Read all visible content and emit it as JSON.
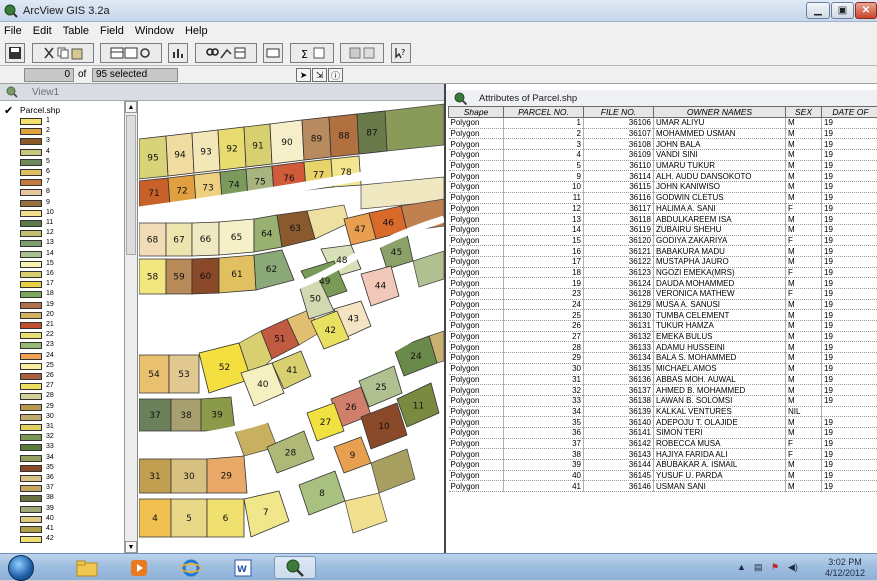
{
  "window": {
    "title": "ArcView GIS 3.2a"
  },
  "menu": [
    "File",
    "Edit",
    "Table",
    "Field",
    "Window",
    "Help"
  ],
  "status": {
    "selected_count": "0",
    "of_label": "of",
    "total": "95",
    "selected_label": "selected"
  },
  "view": {
    "title": "View1",
    "layer_name": "Parcel.shp",
    "legend": [
      {
        "label": "1",
        "color": "#f4e26a"
      },
      {
        "label": "2",
        "color": "#e0a23c"
      },
      {
        "label": "3",
        "color": "#8f5a2a"
      },
      {
        "label": "4",
        "color": "#c8c77f"
      },
      {
        "label": "5",
        "color": "#6f8a5a"
      },
      {
        "label": "6",
        "color": "#e0c060"
      },
      {
        "label": "7",
        "color": "#c47a3e"
      },
      {
        "label": "8",
        "color": "#e8c8a0"
      },
      {
        "label": "9",
        "color": "#9a7040"
      },
      {
        "label": "10",
        "color": "#f0e090"
      },
      {
        "label": "11",
        "color": "#5c7a4a"
      },
      {
        "label": "12",
        "color": "#c0c070"
      },
      {
        "label": "13",
        "color": "#7f9e6e"
      },
      {
        "label": "14",
        "color": "#a8c090"
      },
      {
        "label": "15",
        "color": "#f7f0b0"
      },
      {
        "label": "16",
        "color": "#d8d070"
      },
      {
        "label": "17",
        "color": "#e8d040"
      },
      {
        "label": "18",
        "color": "#7aa65c"
      },
      {
        "label": "19",
        "color": "#b0704a"
      },
      {
        "label": "20",
        "color": "#d4b060"
      },
      {
        "label": "21",
        "color": "#c05030"
      },
      {
        "label": "22",
        "color": "#e8e070"
      },
      {
        "label": "23",
        "color": "#98b878"
      },
      {
        "label": "24",
        "color": "#f0a050"
      },
      {
        "label": "25",
        "color": "#f8f0a0"
      },
      {
        "label": "26",
        "color": "#a86040"
      },
      {
        "label": "27",
        "color": "#f0e060"
      },
      {
        "label": "28",
        "color": "#d0d098"
      },
      {
        "label": "29",
        "color": "#b89a50"
      },
      {
        "label": "30",
        "color": "#c0a870"
      },
      {
        "label": "31",
        "color": "#e0d060"
      },
      {
        "label": "32",
        "color": "#7a9858"
      },
      {
        "label": "33",
        "color": "#5a7a3a"
      },
      {
        "label": "34",
        "color": "#9aa060"
      },
      {
        "label": "35",
        "color": "#8a4a2a"
      },
      {
        "label": "36",
        "color": "#d8c088"
      },
      {
        "label": "37",
        "color": "#c8a860"
      },
      {
        "label": "38",
        "color": "#6a7040"
      },
      {
        "label": "39",
        "color": "#a0a878"
      },
      {
        "label": "40",
        "color": "#e0c880"
      },
      {
        "label": "41",
        "color": "#b0a048"
      },
      {
        "label": "42",
        "color": "#eee070"
      }
    ],
    "parcels": [
      {
        "n": "95",
        "c": "#d8d278"
      },
      {
        "n": "94",
        "c": "#f0dca0"
      },
      {
        "n": "93",
        "c": "#f3e7b8"
      },
      {
        "n": "92",
        "c": "#e8dc70"
      },
      {
        "n": "91",
        "c": "#d8d070"
      },
      {
        "n": "90",
        "c": "#f6eec8"
      },
      {
        "n": "89",
        "c": "#b88a60"
      },
      {
        "n": "88",
        "c": "#b07040"
      },
      {
        "n": "87",
        "c": "#6a7a4a"
      },
      {
        "n": "71",
        "c": "#c8602a"
      },
      {
        "n": "72",
        "c": "#e0a040"
      },
      {
        "n": "73",
        "c": "#eed080"
      },
      {
        "n": "74",
        "c": "#7c9a5c"
      },
      {
        "n": "75",
        "c": "#a8b480"
      },
      {
        "n": "76",
        "c": "#d05a3a"
      },
      {
        "n": "77",
        "c": "#e8d46a"
      },
      {
        "n": "78",
        "c": "#f2e690"
      },
      {
        "n": "68",
        "c": "#f2dcb8"
      },
      {
        "n": "67",
        "c": "#eee4b0"
      },
      {
        "n": "66",
        "c": "#f0e8c0"
      },
      {
        "n": "65",
        "c": "#f6f0c8"
      },
      {
        "n": "64",
        "c": "#98b070"
      },
      {
        "n": "63",
        "c": "#8a5a2e"
      },
      {
        "n": "47",
        "c": "#e8a050"
      },
      {
        "n": "46",
        "c": "#d86a2a"
      },
      {
        "n": "58",
        "c": "#f2e680"
      },
      {
        "n": "59",
        "c": "#b88a5a"
      },
      {
        "n": "60",
        "c": "#8a4a2a"
      },
      {
        "n": "61",
        "c": "#e0c060"
      },
      {
        "n": "62",
        "c": "#8aa878"
      },
      {
        "n": "48",
        "c": "#d8e0b8"
      },
      {
        "n": "45",
        "c": "#8aa26a"
      },
      {
        "n": "49",
        "c": "#7a9a58"
      },
      {
        "n": "44",
        "c": "#f2c8b8"
      },
      {
        "n": "50",
        "c": "#d2d8b0"
      },
      {
        "n": "43",
        "c": "#f4e4c4"
      },
      {
        "n": "42",
        "c": "#e8e060"
      },
      {
        "n": "51",
        "c": "#c05a40"
      },
      {
        "n": "54",
        "c": "#e8c070"
      },
      {
        "n": "53",
        "c": "#e0c890"
      },
      {
        "n": "52",
        "c": "#f3e040"
      },
      {
        "n": "41",
        "c": "#d8d070"
      },
      {
        "n": "24",
        "c": "#6a8a4a"
      },
      {
        "n": "25",
        "c": "#b0c090"
      },
      {
        "n": "40",
        "c": "#f6f0c0"
      },
      {
        "n": "37",
        "c": "#6a805a"
      },
      {
        "n": "38",
        "c": "#a8a070"
      },
      {
        "n": "39",
        "c": "#8a9a48"
      },
      {
        "n": "26",
        "c": "#d0806a"
      },
      {
        "n": "11",
        "c": "#7a8a40"
      },
      {
        "n": "27",
        "c": "#f0e040"
      },
      {
        "n": "10",
        "c": "#8a4a2a"
      },
      {
        "n": "28",
        "c": "#b0b878"
      },
      {
        "n": "9",
        "c": "#e8a050"
      },
      {
        "n": "31",
        "c": "#c0a050"
      },
      {
        "n": "30",
        "c": "#d8c080"
      },
      {
        "n": "29",
        "c": "#e8a868"
      },
      {
        "n": "8",
        "c": "#a8c080"
      },
      {
        "n": "4",
        "c": "#f0c050"
      },
      {
        "n": "5",
        "c": "#e8d888"
      },
      {
        "n": "6",
        "c": "#f0e070"
      },
      {
        "n": "7",
        "c": "#f0e68a"
      }
    ]
  },
  "attributes": {
    "title": "Attributes of Parcel.shp",
    "columns": [
      "Shape",
      "PARCEL NO.",
      "FILE NO.",
      "OWNER NAMES",
      "SEX",
      "DATE OF"
    ],
    "rows": [
      [
        "Polygon",
        "1",
        "36106",
        "UMAR ALIYU",
        "M",
        "19"
      ],
      [
        "Polygon",
        "2",
        "36107",
        "MOHAMMED USMAN",
        "M",
        "19"
      ],
      [
        "Polygon",
        "3",
        "36108",
        "JOHN BALA",
        "M",
        "19"
      ],
      [
        "Polygon",
        "4",
        "36109",
        "VANDI SINI",
        "M",
        "19"
      ],
      [
        "Polygon",
        "5",
        "36110",
        "UMARU TUKUR",
        "M",
        "19"
      ],
      [
        "Polygon",
        "9",
        "36114",
        "ALH. AUDU DANSOKOTO",
        "M",
        "19"
      ],
      [
        "Polygon",
        "10",
        "36115",
        "JOHN KANIWISO",
        "M",
        "19"
      ],
      [
        "Polygon",
        "11",
        "36116",
        "GODWIN CLETUS",
        "M",
        "19"
      ],
      [
        "Polygon",
        "12",
        "36117",
        "HALIMA A. SANI",
        "F",
        "19"
      ],
      [
        "Polygon",
        "13",
        "36118",
        "ABDULKAREEM ISA",
        "M",
        "19"
      ],
      [
        "Polygon",
        "14",
        "36119",
        "ZUBAIRU SHEHU",
        "M",
        "19"
      ],
      [
        "Polygon",
        "15",
        "36120",
        "GODIYA ZAKARIYA",
        "F",
        "19"
      ],
      [
        "Polygon",
        "16",
        "36121",
        "BABAKURA MADU",
        "M",
        "19"
      ],
      [
        "Polygon",
        "17",
        "36122",
        "MUSTAPHA JAURO",
        "M",
        "19"
      ],
      [
        "Polygon",
        "18",
        "36123",
        "NGOZI EMEKA(MRS)",
        "F",
        "19"
      ],
      [
        "Polygon",
        "19",
        "36124",
        "DAUDA MOHAMMED",
        "M",
        "19"
      ],
      [
        "Polygon",
        "23",
        "36128",
        "VERONICA MATHEW",
        "F",
        "19"
      ],
      [
        "Polygon",
        "24",
        "36129",
        "MUSA A. SANUSI",
        "M",
        "19"
      ],
      [
        "Polygon",
        "25",
        "36130",
        "TUMBA CELEMENT",
        "M",
        "19"
      ],
      [
        "Polygon",
        "26",
        "36131",
        "TUKUR HAMZA",
        "M",
        "19"
      ],
      [
        "Polygon",
        "27",
        "36132",
        "EMEKA BULUS",
        "M",
        "19"
      ],
      [
        "Polygon",
        "28",
        "36133",
        "ADAMU HUSSEINI",
        "M",
        "19"
      ],
      [
        "Polygon",
        "29",
        "36134",
        "BALA S. MOHAMMED",
        "M",
        "19"
      ],
      [
        "Polygon",
        "30",
        "36135",
        "MICHAEL AMOS",
        "M",
        "19"
      ],
      [
        "Polygon",
        "31",
        "36136",
        "ABBAS MOH. AUWAL",
        "M",
        "19"
      ],
      [
        "Polygon",
        "32",
        "36137",
        "AHMED B. MOHAMMED",
        "M",
        "19"
      ],
      [
        "Polygon",
        "33",
        "36138",
        "LAWAN B. SOLOMSI",
        "M",
        "19"
      ],
      [
        "Polygon",
        "34",
        "36139",
        "KALKAL VENTURES",
        "NIL",
        ""
      ],
      [
        "Polygon",
        "35",
        "36140",
        "ADEPOJU T. OLAJIDE",
        "M",
        "19"
      ],
      [
        "Polygon",
        "36",
        "36141",
        "SIMON TERI",
        "M",
        "19"
      ],
      [
        "Polygon",
        "37",
        "36142",
        "ROBECCA MUSA",
        "F",
        "19"
      ],
      [
        "Polygon",
        "38",
        "36143",
        "HAJIYA FARIDA ALI",
        "F",
        "19"
      ],
      [
        "Polygon",
        "39",
        "36144",
        "ABUBAKAR A. ISMAIL",
        "M",
        "19"
      ],
      [
        "Polygon",
        "40",
        "36145",
        "YUSUF U. PARDA",
        "M",
        "19"
      ],
      [
        "Polygon",
        "41",
        "36146",
        "USMAN SANI",
        "M",
        "19"
      ]
    ]
  },
  "taskbar": {
    "time": "3:02 PM",
    "date": "4/12/2012"
  }
}
